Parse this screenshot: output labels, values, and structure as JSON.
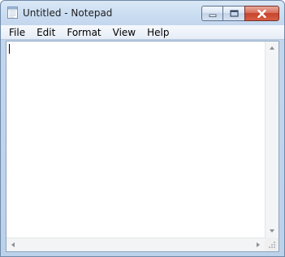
{
  "window": {
    "title": "Untitled - Notepad",
    "icon": "notepad-icon"
  },
  "caption_buttons": {
    "minimize_icon": "minimize-icon",
    "maximize_icon": "maximize-icon",
    "close_icon": "close-icon",
    "close_color": "#c7432c"
  },
  "menu": {
    "items": [
      "File",
      "Edit",
      "Format",
      "View",
      "Help"
    ]
  },
  "editor": {
    "content": ""
  },
  "scrollbars": {
    "vertical": {
      "up_icon": "arrow-up-icon",
      "down_icon": "arrow-down-icon"
    },
    "horizontal": {
      "left_icon": "arrow-left-icon",
      "right_icon": "arrow-right-icon"
    }
  },
  "colors": {
    "frame": "#c3d6ed",
    "editor_bg": "#ffffff"
  }
}
